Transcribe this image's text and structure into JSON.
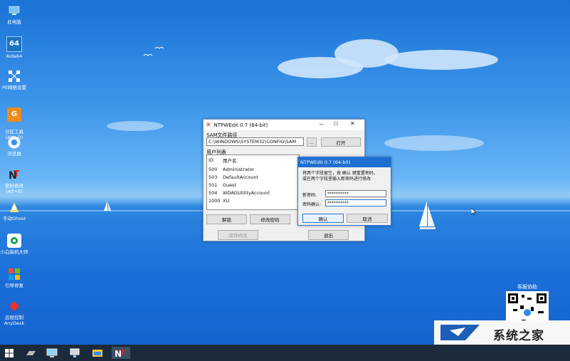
{
  "desktop_icons": [
    {
      "label": "此电脑",
      "icon": "computer-icon"
    },
    {
      "label": "Aida64",
      "icon": "aida64-icon",
      "glyph": "64"
    },
    {
      "label": "PE网络设置",
      "icon": "network-icon"
    },
    {
      "label": "分区工具\n(Alt+D)",
      "icon": "partition-tool-icon",
      "glyph": "G"
    },
    {
      "label": "浏览器",
      "icon": "browser-icon"
    },
    {
      "label": "密码修改\n(Alt+E)",
      "icon": "password-tool-icon"
    },
    {
      "label": "手动Ghost",
      "icon": "ghost-icon"
    },
    {
      "label": "小白装机大师",
      "icon": "installer-icon"
    },
    {
      "label": "引导修复",
      "icon": "boot-repair-icon"
    },
    {
      "label": "远程控制\nAnyDesk",
      "icon": "anydesk-icon"
    }
  ],
  "main_window": {
    "title": "NTPWEdit 0.7 (64-bit)",
    "sam_path_label": "SAM文件路径",
    "sam_path_value": "C:\\WINDOWS\\SYSTEM32\\CONFIG\\SAM",
    "browse_label": "...",
    "open_label": "打开",
    "user_list_label": "用户列表",
    "columns": [
      "ID",
      "用户名"
    ],
    "users": [
      {
        "id": "500",
        "name": "Administrator"
      },
      {
        "id": "503",
        "name": "DefaultAccount"
      },
      {
        "id": "501",
        "name": "Guest"
      },
      {
        "id": "504",
        "name": "WDAGUtilityAccount"
      },
      {
        "id": "1000",
        "name": "XU"
      }
    ],
    "unlock_label": "解锁",
    "change_password_label": "修改密码",
    "save_label": "保存修改",
    "exit_label": "退出"
  },
  "dialog": {
    "title": "NTPWEdit 0.7 (64-bit)",
    "instructions_line1": "将两个字段留空，按 确认 键重置密码，",
    "instructions_line2": "或在两个字段里输入新密码进行修改",
    "new_password_label": "新密码:",
    "new_password_value": "**********",
    "confirm_password_label": "密码确认:",
    "confirm_password_value": "**********",
    "ok_label": "确认",
    "cancel_label": "取消"
  },
  "qr_caption": "客服协助",
  "watermark": {
    "text": "系统之家"
  },
  "colors": {
    "accent": "#0078d7",
    "title_blue": "#cc2222"
  }
}
